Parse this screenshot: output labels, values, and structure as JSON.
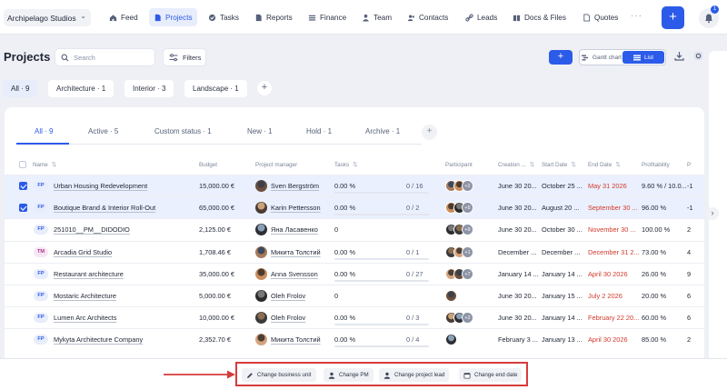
{
  "app": {
    "workspace": "Archipelago Studios",
    "nav": [
      {
        "label": "Feed",
        "icon": "home-icon",
        "active": false
      },
      {
        "label": "Projects",
        "icon": "file-icon",
        "active": true
      },
      {
        "label": "Tasks",
        "icon": "check-circle-icon",
        "active": false
      },
      {
        "label": "Reports",
        "icon": "file-icon",
        "active": false
      },
      {
        "label": "Finance",
        "icon": "list-icon",
        "active": false
      },
      {
        "label": "Team",
        "icon": "person-icon",
        "active": false
      },
      {
        "label": "Contacts",
        "icon": "contacts-icon",
        "active": false
      },
      {
        "label": "Leads",
        "icon": "link-icon",
        "active": false
      },
      {
        "label": "Docs & Files",
        "icon": "docs-icon",
        "active": false
      },
      {
        "label": "Quotes",
        "icon": "file-icon",
        "active": false
      }
    ],
    "more_label": "···",
    "add_label": "+",
    "notification_count": "1"
  },
  "page": {
    "title": "Projects",
    "search_placeholder": "Search",
    "filters_label": "Filters",
    "add_label": "+",
    "view_gantt": "Gantt chart",
    "view_list": "List"
  },
  "categories": [
    {
      "label": "All · 9",
      "selected": true
    },
    {
      "label": "Architecture · 1",
      "selected": false
    },
    {
      "label": "Interior · 3",
      "selected": false
    },
    {
      "label": "Landscape · 1",
      "selected": false
    }
  ],
  "category_add": "+",
  "status_tabs": [
    {
      "label": "All · 9",
      "active": true
    },
    {
      "label": "Active · 5",
      "active": false
    },
    {
      "label": "Custom status · 1",
      "active": false
    },
    {
      "label": "New · 1",
      "active": false
    },
    {
      "label": "Hold · 1",
      "active": false
    },
    {
      "label": "Archive · 1",
      "active": false
    }
  ],
  "status_tab_add": "+",
  "columns": {
    "name": "Name",
    "budget": "Budget",
    "pm": "Project manager",
    "tasks": "Tasks",
    "participant": "Participant",
    "created": "Creation ...",
    "start": "Start Date",
    "end": "End Date",
    "profitability": "Profitability",
    "extra": "P"
  },
  "rows": [
    {
      "selected": true,
      "tag": "FP",
      "name": "Urban Housing Redevelopment",
      "budget": "15,000.00 €",
      "pm": "Sven Bergström",
      "task_pct": "0.00 %",
      "task_frac": "0 / 16",
      "participants_more": "+2",
      "created": "June 30 20...",
      "start": "October 25 ...",
      "end": "May 31 2026",
      "profit": "9.60 % / 10.0...",
      "extra": "-1"
    },
    {
      "selected": true,
      "tag": "FP",
      "name": "Boutique Brand & Interior Roll-Out",
      "budget": "65,000.00 €",
      "pm": "Karin Pettersson",
      "task_pct": "0.00 %",
      "task_frac": "0 / 2",
      "participants_more": "+5",
      "created": "June 30 20...",
      "start": "August 20 ...",
      "end": "September 30 ...",
      "profit": "96.00 %",
      "extra": "-1"
    },
    {
      "selected": false,
      "tag": "FP",
      "name": "251010__PM__DIDODIO",
      "budget": "2,125.00 €",
      "pm": "Яна Ласавенко",
      "task_pct": "0",
      "task_frac": "",
      "participants_more": "+9",
      "created": "June 30 20...",
      "start": "October 30 ...",
      "end": "November 30 ...",
      "profit": "100.00 %",
      "extra": "2"
    },
    {
      "selected": false,
      "tag": "TM",
      "name": "Arcadia Grid Studio",
      "budget": "1,708.46 €",
      "pm": "Микита Толстий",
      "task_pct": "0.00 %",
      "task_frac": "0 / 1",
      "participants_more": "+1",
      "created": "December ...",
      "start": "December ...",
      "end": "December 31 2...",
      "profit": "73.00 %",
      "extra": "4"
    },
    {
      "selected": false,
      "tag": "FP",
      "name": "Restaurant architecture",
      "budget": "35,000.00 €",
      "pm": "Anna Svensson",
      "task_pct": "0.00 %",
      "task_frac": "0 / 27",
      "participants_more": "+7",
      "created": "January 14 ...",
      "start": "January 14 ...",
      "end": "April 30 2026",
      "profit": "26.00 %",
      "extra": "9"
    },
    {
      "selected": false,
      "tag": "FP",
      "name": "Mostaric Architecture",
      "budget": "5,000.00 €",
      "pm": "Oleh Frolov",
      "task_pct": "0",
      "task_frac": "",
      "participants_more": "",
      "created": "June 30 20...",
      "start": "January 15 ...",
      "end": "July 2 2026",
      "profit": "20.00 %",
      "extra": "6"
    },
    {
      "selected": false,
      "tag": "FP",
      "name": "Lumen Arc Architects",
      "budget": "10,000.00 €",
      "pm": "Oleh Frolov",
      "task_pct": "0.00 %",
      "task_frac": "0 / 3",
      "participants_more": "+2",
      "created": "June 30 20...",
      "start": "January 14 ...",
      "end": "February 22 20...",
      "profit": "60.00 %",
      "extra": "6"
    },
    {
      "selected": false,
      "tag": "FP",
      "name": "Mykyta Architecture Company",
      "budget": "2,352.70 €",
      "pm": "Микита Толстий",
      "task_pct": "0.00 %",
      "task_frac": "0 / 4",
      "participants_more": "",
      "created": "February 3 ...",
      "start": "January 13 ...",
      "end": "April 30 2026",
      "profit": "85.00 %",
      "extra": "2"
    }
  ],
  "bulk_actions": [
    {
      "label": "Change business unit",
      "icon": "pencil-icon"
    },
    {
      "label": "Change PM",
      "icon": "person-icon"
    },
    {
      "label": "Change project lead",
      "icon": "person-icon"
    },
    {
      "label": "Change end date",
      "icon": "calendar-icon"
    }
  ],
  "colors": {
    "accent": "#2b5be8",
    "overdue": "#d33a2c",
    "highlight_box": "#d63c3c"
  }
}
